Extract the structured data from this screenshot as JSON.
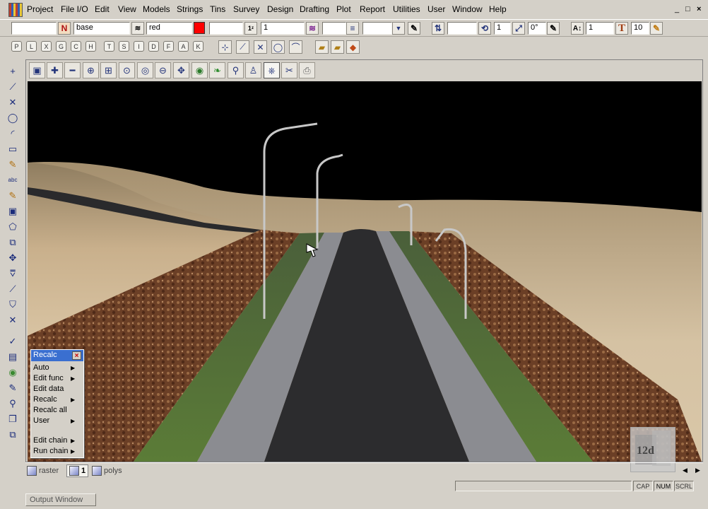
{
  "menubar": {
    "items": [
      "Project",
      "File I/O",
      "Edit",
      "View",
      "Models",
      "Strings",
      "Tins",
      "Survey",
      "Design",
      "Drafting",
      "Plot",
      "Report",
      "Utilities",
      "User",
      "Window",
      "Help"
    ],
    "window_controls": [
      "_",
      "□",
      "×"
    ]
  },
  "toolbar": {
    "name_value": "",
    "model_value": "base",
    "colour_value": "red",
    "colour_swatch": "#ff0000",
    "style_value": "",
    "weight_value": "1",
    "linestyle_value": "",
    "chainage_value": "",
    "text_size_value": "1",
    "angle_value": "0°",
    "text_height_value": "1",
    "text_font_size_value": "10"
  },
  "snaps": {
    "keys": [
      "P",
      "L",
      "X",
      "G",
      "C",
      "H",
      "T",
      "S",
      "I",
      "D",
      "F",
      "A",
      "K"
    ]
  },
  "recalc_panel": {
    "title": "Recalc",
    "items": [
      {
        "label": "Auto",
        "submenu": true
      },
      {
        "label": "Edit func",
        "submenu": true
      },
      {
        "label": "Edit data",
        "submenu": false
      },
      {
        "label": "Recalc",
        "submenu": true
      },
      {
        "label": "Recalc all",
        "submenu": false
      },
      {
        "label": "User",
        "submenu": true
      },
      {
        "label": "Edit chain",
        "submenu": true
      },
      {
        "label": "Run chain",
        "submenu": true
      }
    ]
  },
  "view_tabs": {
    "tabs": [
      "raster",
      "1",
      "polys"
    ],
    "active": "1",
    "nav_left": "◀",
    "nav_right": "▶"
  },
  "status": {
    "caps": "CAP",
    "num": "NUM",
    "scroll": "SCRL"
  },
  "output_window": {
    "label": "Output Window"
  },
  "logo": {
    "text": "12d"
  },
  "colors": {
    "sky": "#000000",
    "terrain": "#cbb28f",
    "embankment": "#7a4a2e",
    "grass": "#4b6b2c",
    "footpath": "#8c8d92",
    "road": "#2b2b2d",
    "title_bar": "#3a6fd0"
  }
}
